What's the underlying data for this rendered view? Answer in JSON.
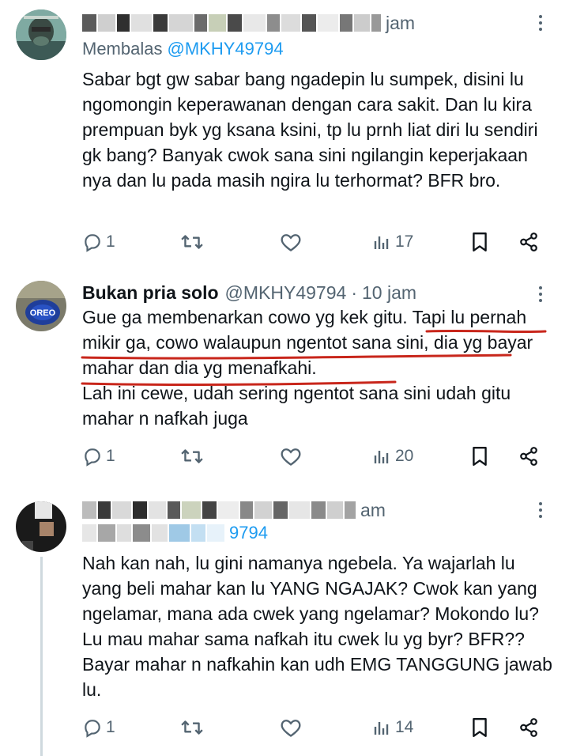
{
  "posts": [
    {
      "author_name": "",
      "author_handle": "",
      "time": "jam",
      "replying_label": "Membalas",
      "replying_to": "@MKHY49794",
      "text": "Sabar bgt gw sabar bang ngadepin lu sumpek, disini lu ngomongin keperawanan dengan cara sakit. Dan lu kira prempuan byk yg ksana ksini, tp lu prnh liat diri lu sendiri gk bang? Banyak cwok sana sini ngilangin keperjakaan nya dan lu pada masih ngira lu terhormat? BFR bro.",
      "replies": "1",
      "reposts": "",
      "likes": "",
      "views": "17"
    },
    {
      "author_name": "Bukan pria solo",
      "author_handle": "@MKHY49794",
      "separator": "·",
      "time": "10 jam",
      "avatar_text": "OREO",
      "text": "Gue ga membenarkan cowo yg kek gitu. Tapi lu pernah mikir ga, cowo walaupun ngentot sana sini, dia yg bayar mahar dan dia yg menafkahi.\nLah ini cewe, udah sering ngentot sana sini udah gitu mahar n nafkah juga",
      "replies": "1",
      "reposts": "",
      "likes": "",
      "views": "20"
    },
    {
      "author_name": "",
      "author_handle": "",
      "time": "am",
      "replying_to": "9794",
      "text": "Nah kan nah, lu gini namanya ngebela. Ya wajarlah lu yang beli mahar kan lu YANG NGAJAK? Cwok kan yang ngelamar, mana ada cwek yang ngelamar? Mokondo lu? Lu mau mahar sama nafkah itu cwek lu yg byr? BFR?? Bayar mahar n nafkahin kan udh EMG TANGGUNG jawab lu.",
      "replies": "1",
      "reposts": "",
      "likes": "",
      "views": "14"
    }
  ],
  "icons": {
    "reply": "speech-bubble-icon",
    "repost": "repost-arrows-icon",
    "like": "heart-icon",
    "views": "bar-chart-icon",
    "bookmark": "bookmark-icon",
    "share": "share-icon",
    "more": "more-dots-icon"
  },
  "colors": {
    "text": "#0f1419",
    "secondary": "#536471",
    "link": "#1d9bf0",
    "annotation": "#c8261b",
    "divider": "#eff3f4"
  }
}
